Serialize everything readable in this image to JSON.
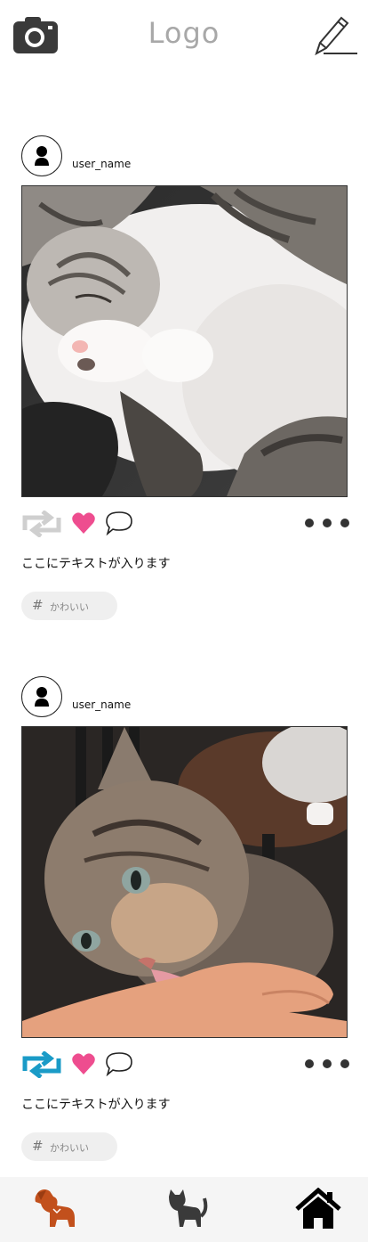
{
  "header": {
    "logo_text": "Logo",
    "left_icon": "camera-icon",
    "right_icon": "pencil-icon"
  },
  "posts": [
    {
      "username": "user_name",
      "caption": "ここにテキストが入ります",
      "tag": "かわいい",
      "retweet_color": "#cfcfcf",
      "heart_color": "#ee4d8f"
    },
    {
      "username": "user_name",
      "caption": "ここにテキストが入ります",
      "tag": "かわいい",
      "retweet_color": "#1a9bc7",
      "heart_color": "#ee4d8f"
    }
  ],
  "nav": {
    "items": [
      "dog-icon",
      "cat-icon",
      "home-icon"
    ],
    "active_color": "#c2501c",
    "inactive_color": "#3a3a3a"
  }
}
